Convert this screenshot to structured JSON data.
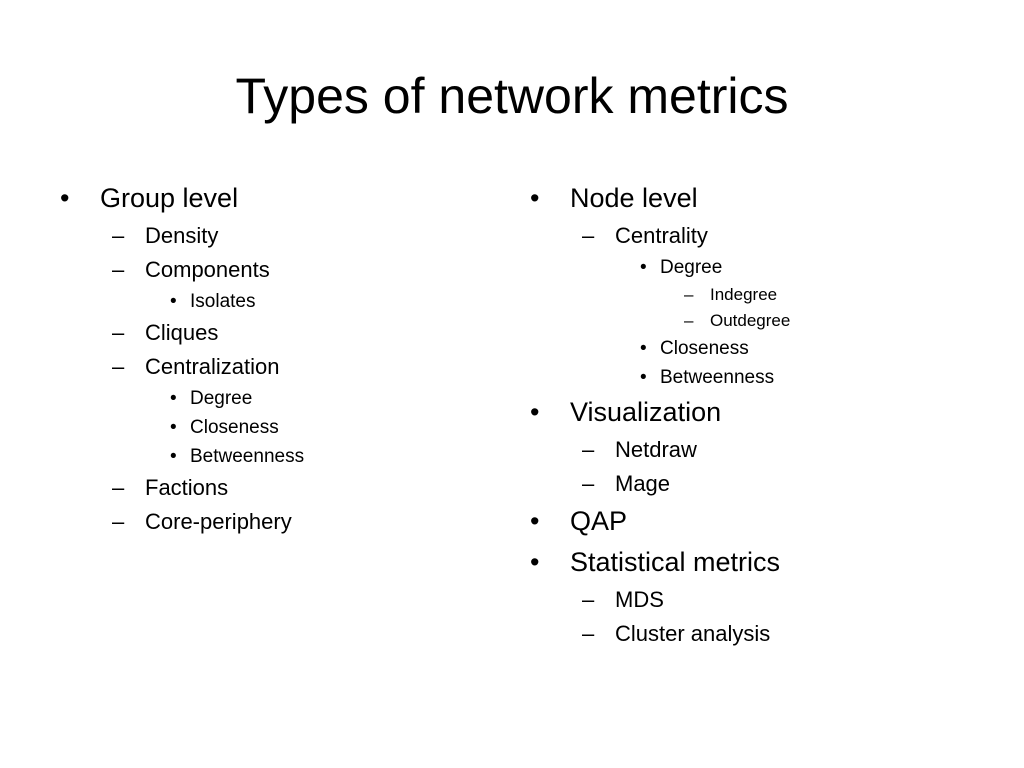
{
  "title": "Types of network metrics",
  "left_column": [
    {
      "level": 1,
      "marker": "•",
      "text": "Group level"
    },
    {
      "level": 2,
      "marker": "–",
      "text": "Density"
    },
    {
      "level": 2,
      "marker": "–",
      "text": "Components"
    },
    {
      "level": 3,
      "marker": "•",
      "text": "Isolates"
    },
    {
      "level": 2,
      "marker": "–",
      "text": "Cliques"
    },
    {
      "level": 2,
      "marker": "–",
      "text": "Centralization"
    },
    {
      "level": 3,
      "marker": "•",
      "text": "Degree"
    },
    {
      "level": 3,
      "marker": "•",
      "text": "Closeness"
    },
    {
      "level": 3,
      "marker": "•",
      "text": "Betweenness"
    },
    {
      "level": 2,
      "marker": "–",
      "text": "Factions"
    },
    {
      "level": 2,
      "marker": "–",
      "text": "Core-periphery"
    }
  ],
  "right_column": [
    {
      "level": 1,
      "marker": "•",
      "text": "Node level"
    },
    {
      "level": 2,
      "marker": "–",
      "text": "Centrality"
    },
    {
      "level": 3,
      "marker": "•",
      "text": "Degree"
    },
    {
      "level": 4,
      "marker": "–",
      "text": "Indegree"
    },
    {
      "level": 4,
      "marker": "–",
      "text": "Outdegree"
    },
    {
      "level": 3,
      "marker": "•",
      "text": "Closeness"
    },
    {
      "level": 3,
      "marker": "•",
      "text": "Betweenness"
    },
    {
      "level": 1,
      "marker": "•",
      "text": "Visualization"
    },
    {
      "level": 2,
      "marker": "–",
      "text": "Netdraw"
    },
    {
      "level": 2,
      "marker": "–",
      "text": "Mage"
    },
    {
      "level": 1,
      "marker": "•",
      "text": "QAP"
    },
    {
      "level": 1,
      "marker": "•",
      "text": "Statistical metrics"
    },
    {
      "level": 2,
      "marker": "–",
      "text": "MDS"
    },
    {
      "level": 2,
      "marker": "–",
      "text": "Cluster analysis"
    }
  ]
}
